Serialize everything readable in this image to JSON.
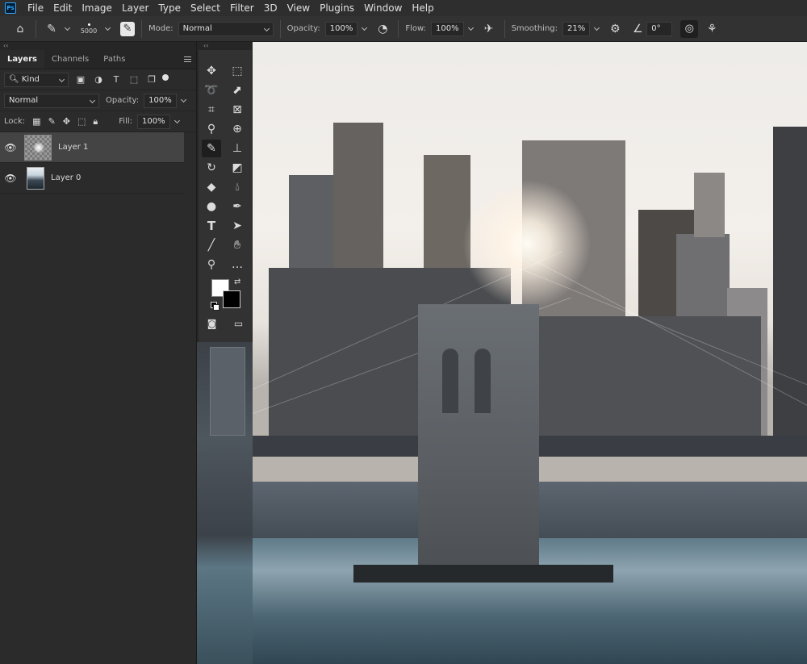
{
  "menubar": {
    "app_icon": "Ps",
    "items": [
      "File",
      "Edit",
      "Image",
      "Layer",
      "Type",
      "Select",
      "Filter",
      "3D",
      "View",
      "Plugins",
      "Window",
      "Help"
    ]
  },
  "options": {
    "brush_size": "5000",
    "mode_label": "Mode:",
    "mode_value": "Normal",
    "opacity_label": "Opacity:",
    "opacity_value": "100%",
    "flow_label": "Flow:",
    "flow_value": "100%",
    "smoothing_label": "Smoothing:",
    "smoothing_value": "21%",
    "angle_value": "0°"
  },
  "layers_panel": {
    "collapse": "‹‹",
    "tabs": [
      "Layers",
      "Channels",
      "Paths"
    ],
    "filter_kind": "Kind",
    "blend_mode": "Normal",
    "opacity_label": "Opacity:",
    "opacity_value": "100%",
    "lock_label": "Lock:",
    "fill_label": "Fill:",
    "fill_value": "100%",
    "layers": [
      {
        "name": "Layer 1",
        "selected": true
      },
      {
        "name": "Layer 0",
        "selected": false
      }
    ]
  },
  "toolbar": {
    "collapse": "‹‹",
    "foreground_color": "#ffffff",
    "background_color": "#000000"
  }
}
